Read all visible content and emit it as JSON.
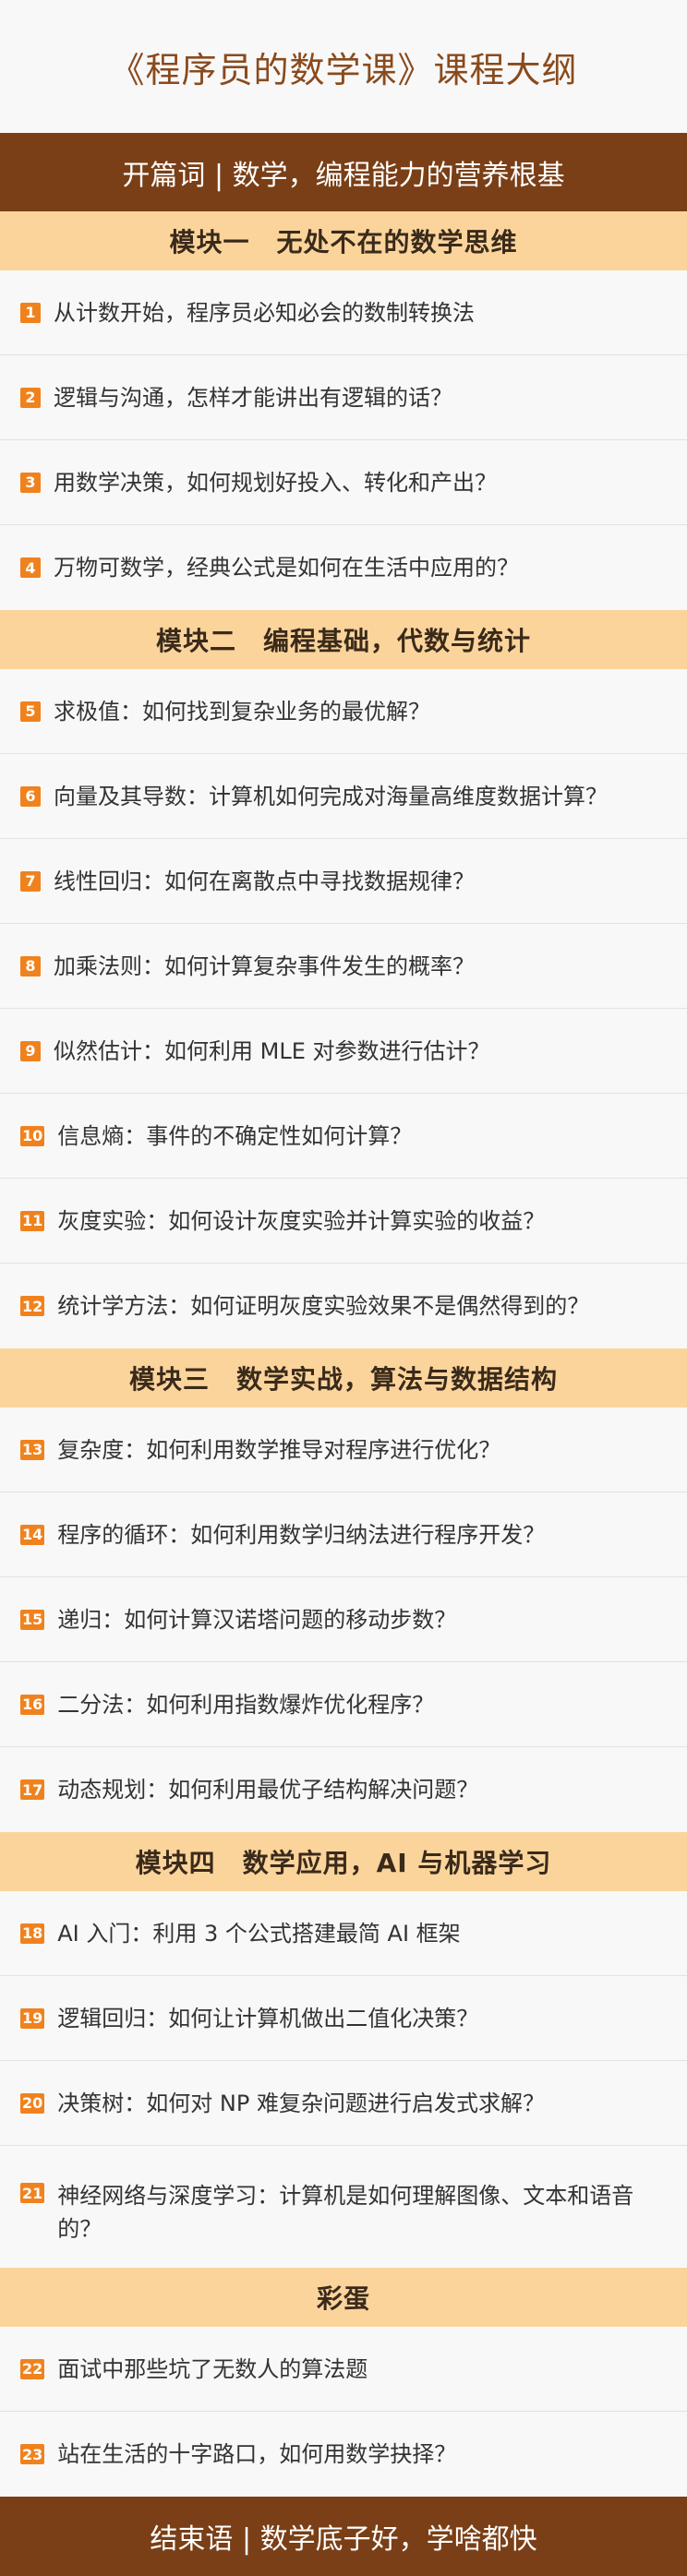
{
  "title": "《程序员的数学课》课程大纲",
  "opening": "开篇词 | 数学，编程能力的营养根基",
  "modules": [
    {
      "title": "模块一　无处不在的数学思维",
      "items": [
        {
          "num": "1",
          "text": "从计数开始，程序员必知必会的数制转换法"
        },
        {
          "num": "2",
          "text": "逻辑与沟通，怎样才能讲出有逻辑的话？"
        },
        {
          "num": "3",
          "text": "用数学决策，如何规划好投入、转化和产出？"
        },
        {
          "num": "4",
          "text": "万物可数学，经典公式是如何在生活中应用的？"
        }
      ]
    },
    {
      "title": "模块二　编程基础，代数与统计",
      "items": [
        {
          "num": "5",
          "text": "求极值：如何找到复杂业务的最优解？"
        },
        {
          "num": "6",
          "text": "向量及其导数：计算机如何完成对海量高维度数据计算？"
        },
        {
          "num": "7",
          "text": "线性回归：如何在离散点中寻找数据规律？"
        },
        {
          "num": "8",
          "text": "加乘法则：如何计算复杂事件发生的概率？"
        },
        {
          "num": "9",
          "text": "似然估计：如何利用 MLE 对参数进行估计？"
        },
        {
          "num": "10",
          "text": "信息熵：事件的不确定性如何计算？"
        },
        {
          "num": "11",
          "text": "灰度实验：如何设计灰度实验并计算实验的收益？"
        },
        {
          "num": "12",
          "text": "统计学方法：如何证明灰度实验效果不是偶然得到的？"
        }
      ]
    },
    {
      "title": "模块三　数学实战，算法与数据结构",
      "items": [
        {
          "num": "13",
          "text": "复杂度：如何利用数学推导对程序进行优化？"
        },
        {
          "num": "14",
          "text": "程序的循环：如何利用数学归纳法进行程序开发？"
        },
        {
          "num": "15",
          "text": "递归：如何计算汉诺塔问题的移动步数？"
        },
        {
          "num": "16",
          "text": "二分法：如何利用指数爆炸优化程序？"
        },
        {
          "num": "17",
          "text": "动态规划：如何利用最优子结构解决问题？"
        }
      ]
    },
    {
      "title": "模块四　数学应用，AI 与机器学习",
      "items": [
        {
          "num": "18",
          "text": "AI 入门：利用 3 个公式搭建最简 AI 框架"
        },
        {
          "num": "19",
          "text": "逻辑回归：如何让计算机做出二值化决策？"
        },
        {
          "num": "20",
          "text": "决策树：如何对 NP 难复杂问题进行启发式求解？"
        },
        {
          "num": "21",
          "text": "神经网络与深度学习：计算机是如何理解图像、文本和语音的？"
        }
      ]
    },
    {
      "title": "彩蛋",
      "items": [
        {
          "num": "22",
          "text": "面试中那些坑了无数人的算法题"
        },
        {
          "num": "23",
          "text": "站在生活的十字路口，如何用数学抉择？"
        }
      ]
    }
  ],
  "closing": "结束语 | 数学底子好，学啥都快",
  "colors": {
    "title": "#8a4a1c",
    "dark_bar": "#7a3f17",
    "module_bar": "#fbd49c",
    "badge": "#f0821e"
  }
}
